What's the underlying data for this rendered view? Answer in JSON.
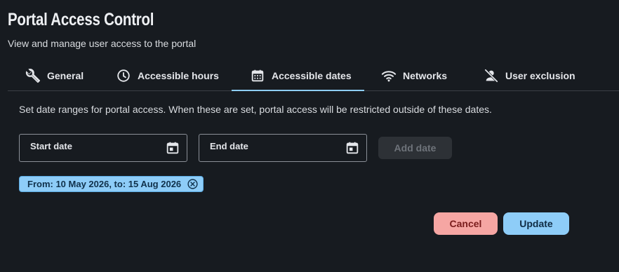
{
  "header": {
    "title": "Portal Access Control",
    "subtitle": "View and manage user access to the portal"
  },
  "tabs": [
    {
      "label": "General",
      "icon": "wrench-icon",
      "active": false
    },
    {
      "label": "Accessible hours",
      "icon": "clock-icon",
      "active": false
    },
    {
      "label": "Accessible dates",
      "icon": "calendar-icon",
      "active": true
    },
    {
      "label": "Networks",
      "icon": "wifi-icon",
      "active": false
    },
    {
      "label": "User exclusion",
      "icon": "user-off-icon",
      "active": false
    }
  ],
  "panel": {
    "description": "Set date ranges for portal access. When these are set, portal access will be restricted outside of these dates.",
    "start_date": {
      "label": "Start date",
      "value": ""
    },
    "end_date": {
      "label": "End date",
      "value": ""
    },
    "add_label": "Add date",
    "date_ranges": [
      {
        "label": "From: 10 May 2026, to: 15 Aug 2026"
      }
    ]
  },
  "actions": {
    "cancel_label": "Cancel",
    "update_label": "Update"
  },
  "colors": {
    "background": "#171b20",
    "accent": "#8ecdf8",
    "cancel": "#f6a6a3",
    "disabled_button": "#2d3136"
  }
}
